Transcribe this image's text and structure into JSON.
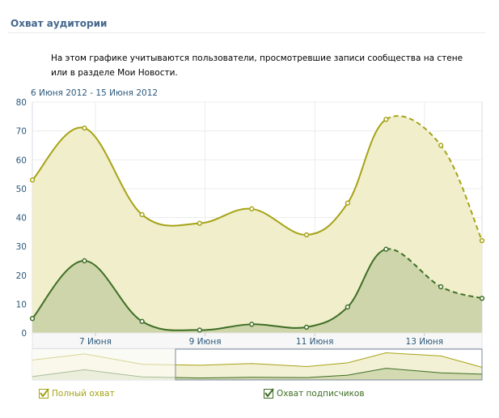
{
  "page": {
    "title": "Охват аудитории",
    "description": "На этом графике учитываются пользователи, просмотревшие записи сообщества на стене или в разделе Мои Новости.",
    "date_range": "6 Июня 2012 - 15 Июня 2012"
  },
  "colors": {
    "full_reach_line": "#a6a316",
    "full_reach_fill": "#f0eecb",
    "subscribers_line": "#3e6e25",
    "subscribers_fill": "#cbd3a8",
    "axis_text": "#2b587a",
    "grid": "#ececec"
  },
  "chart_data": {
    "type": "area",
    "x": [
      0,
      1,
      2,
      3,
      4,
      5,
      6,
      7,
      8
    ],
    "x_ticks": [
      {
        "x": 1,
        "label": "7 Июня"
      },
      {
        "x": 3,
        "label": "9 Июня"
      },
      {
        "x": 5,
        "label": "11 Июня"
      },
      {
        "x": 7,
        "label": "13 Июня"
      }
    ],
    "xlim": [
      -0.15,
      8.05
    ],
    "ylim": [
      0,
      80
    ],
    "y_ticks": [
      0,
      10,
      20,
      30,
      40,
      50,
      60,
      70,
      80
    ],
    "grid": true,
    "dashed_from_index": 7,
    "series": [
      {
        "name": "Полный охват",
        "points": [
          [
            -0.15,
            53
          ],
          [
            0.8,
            71
          ],
          [
            1.85,
            41
          ],
          [
            2.9,
            38
          ],
          [
            3.85,
            43
          ],
          [
            4.85,
            34
          ],
          [
            5.6,
            45
          ],
          [
            6.3,
            74
          ],
          [
            7.3,
            65
          ],
          [
            8.05,
            32
          ]
        ]
      },
      {
        "name": "Охват подписчиков",
        "points": [
          [
            -0.15,
            5
          ],
          [
            0.8,
            25
          ],
          [
            1.85,
            4
          ],
          [
            2.9,
            1
          ],
          [
            3.85,
            3
          ],
          [
            4.85,
            2
          ],
          [
            5.6,
            9
          ],
          [
            6.3,
            29
          ],
          [
            7.3,
            16
          ],
          [
            8.05,
            12
          ]
        ]
      }
    ],
    "legend": [
      {
        "label": "Полный охват",
        "checked": true
      },
      {
        "label": "Охват подписчиков",
        "checked": true
      }
    ]
  }
}
